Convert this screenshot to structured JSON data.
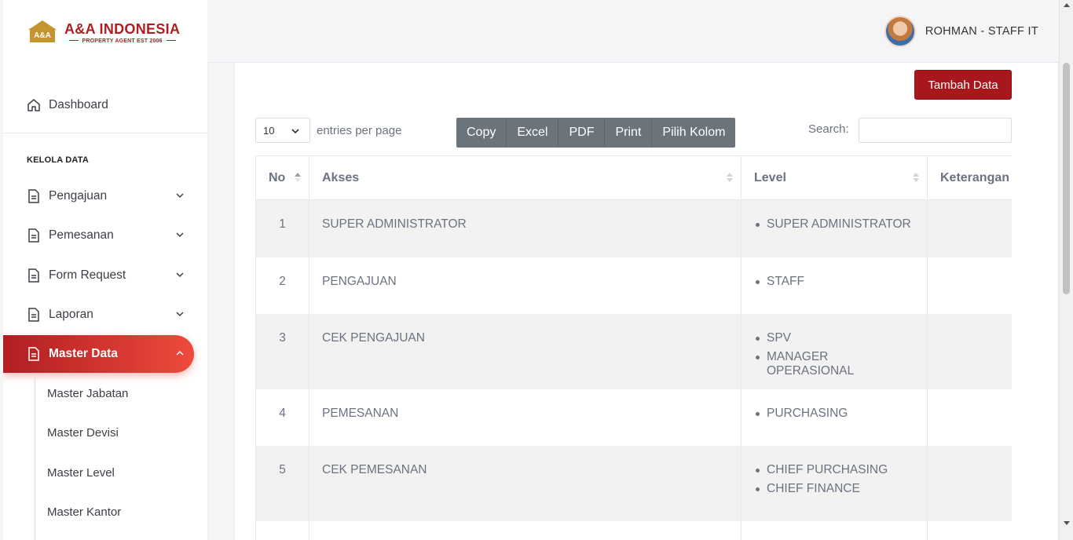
{
  "brand": {
    "name": "A&A INDONESIA",
    "tagline": "PROPERTY AGENT EST 2006",
    "mark_text": "A&A",
    "color": "#b11e22"
  },
  "sidebar": {
    "dashboard_label": "Dashboard",
    "section_label": "KELOLA DATA",
    "items": [
      {
        "label": "Pengajuan",
        "icon": "document-icon"
      },
      {
        "label": "Pemesanan",
        "icon": "document-icon"
      },
      {
        "label": "Form Request",
        "icon": "document-icon"
      },
      {
        "label": "Laporan",
        "icon": "document-icon"
      },
      {
        "label": "Master Data",
        "icon": "document-icon",
        "active": true
      }
    ],
    "sub_items": [
      "Master Jabatan",
      "Master Devisi",
      "Master Level",
      "Master Kantor"
    ]
  },
  "header": {
    "user_label": "ROHMAN - STAFF IT"
  },
  "toolbar": {
    "add_button": "Tambah Data",
    "entries_value": "10",
    "entries_text": "entries per page",
    "buttons": [
      "Copy",
      "Excel",
      "PDF",
      "Print",
      "Pilih Kolom"
    ],
    "search_label": "Search:",
    "search_value": ""
  },
  "table": {
    "columns": [
      "No",
      "Akses",
      "Level",
      "Keterangan"
    ],
    "rows": [
      {
        "no": "1",
        "akses": "SUPER ADMINISTRATOR",
        "levels": [
          "SUPER ADMINISTRATOR"
        ]
      },
      {
        "no": "2",
        "akses": "PENGAJUAN",
        "levels": [
          "STAFF"
        ]
      },
      {
        "no": "3",
        "akses": "CEK PENGAJUAN",
        "levels": [
          "SPV",
          "MANAGER OPERASIONAL"
        ]
      },
      {
        "no": "4",
        "akses": "PEMESANAN",
        "levels": [
          "PURCHASING"
        ]
      },
      {
        "no": "5",
        "akses": "CEK PEMESANAN",
        "levels": [
          "CHIEF PURCHASING",
          "CHIEF FINANCE"
        ]
      }
    ]
  },
  "colors": {
    "accent": "#b01e23",
    "accent_light": "#ee4a3c",
    "button_group": "#6b737b"
  }
}
